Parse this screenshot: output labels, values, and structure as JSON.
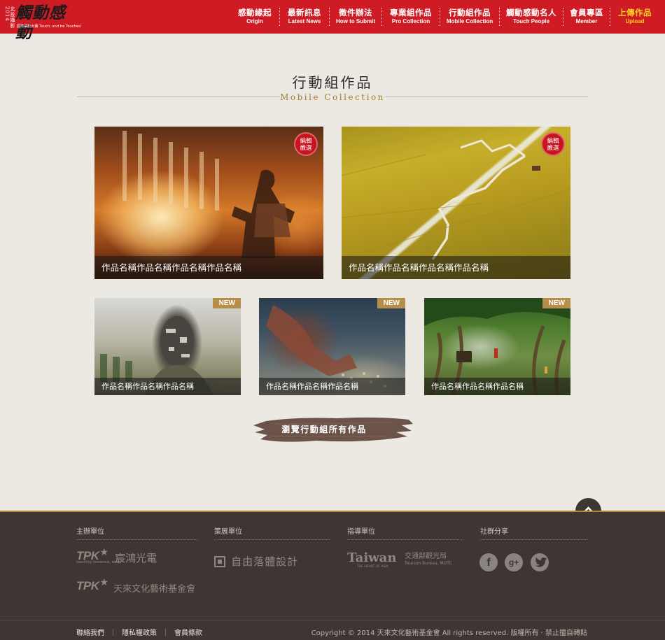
{
  "header": {
    "logo": {
      "year": "2014",
      "vertical": "北投攝影",
      "brand": "觸動感動",
      "subtitle": "國際攝影大賽 Touch, and be Touched"
    },
    "nav": [
      {
        "zh": "感動緣起",
        "en": "Origin"
      },
      {
        "zh": "最新訊息",
        "en": "Latest News"
      },
      {
        "zh": "徵件辦法",
        "en": "How to Submit"
      },
      {
        "zh": "專業組作品",
        "en": "Pro Collection"
      },
      {
        "zh": "行動組作品",
        "en": "Mobile Collection"
      },
      {
        "zh": "觸動感動名人",
        "en": "Touch People"
      },
      {
        "zh": "會員專區",
        "en": "Member"
      },
      {
        "zh": "上傳作品",
        "en": "Upload"
      }
    ],
    "active_color": "#ffd21f",
    "bar_color": "#cf1b24"
  },
  "section": {
    "title_zh": "行動組作品",
    "title_en": "Mobile Collection"
  },
  "featured": [
    {
      "caption": "作品名稱作品名稱作品名稱作品名稱",
      "badge": "編輯嚴選"
    },
    {
      "caption": "作品名稱作品名稱作品名稱作品名稱",
      "badge": "編輯嚴選"
    }
  ],
  "works": [
    {
      "caption": "作品名稱作品名稱作品名稱",
      "badge": "NEW"
    },
    {
      "caption": "作品名稱作品名稱作品名稱",
      "badge": "NEW"
    },
    {
      "caption": "作品名稱作品名稱作品名稱",
      "badge": "NEW"
    }
  ],
  "browse_all": "瀏覽行動組所有作品",
  "footer": {
    "columns": [
      {
        "heading": "主辦單位",
        "logos": [
          "TPK 宸鴻光電",
          "TPK 天來文化藝術基金會"
        ],
        "tagline": "touching tomorrow, today"
      },
      {
        "heading": "策展單位",
        "logos": [
          "自由落體設計"
        ]
      },
      {
        "heading": "指導單位",
        "logos": [
          "Taiwan",
          "交通部觀光局"
        ],
        "taiwan_tag": "THE HEART OF ASIA",
        "bureau_en": "Tourism Bureau, MOTC"
      },
      {
        "heading": "社群分享",
        "icons": [
          "facebook-icon",
          "google-plus-icon",
          "twitter-icon"
        ]
      }
    ],
    "links": [
      "聯絡我們",
      "隱私權政策",
      "會員條款"
    ],
    "copyright": "Copyright © 2014 天來文化藝術基金會 All rights reserved. 版權所有 · 禁止擅自轉貼"
  }
}
